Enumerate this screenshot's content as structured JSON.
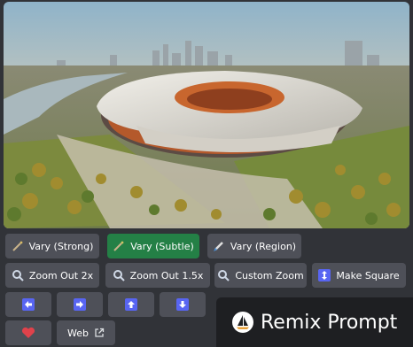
{
  "image": {
    "alt_icon": "stadium-render-image"
  },
  "buttons": {
    "vary_strong": "Vary (Strong)",
    "vary_subtle": "Vary (Subtle)",
    "vary_region": "Vary (Region)",
    "zoom_out_2x": "Zoom Out 2x",
    "zoom_out_15x": "Zoom Out 1.5x",
    "custom_zoom": "Custom Zoom",
    "make_square": "Make Square",
    "web": "Web"
  },
  "remix": {
    "title": "Remix Prompt"
  },
  "colors": {
    "background": "#313338",
    "button": "#4e5058",
    "button_active": "#248046",
    "heart": "#e0424b",
    "arrow_badge": "#5865f2"
  }
}
